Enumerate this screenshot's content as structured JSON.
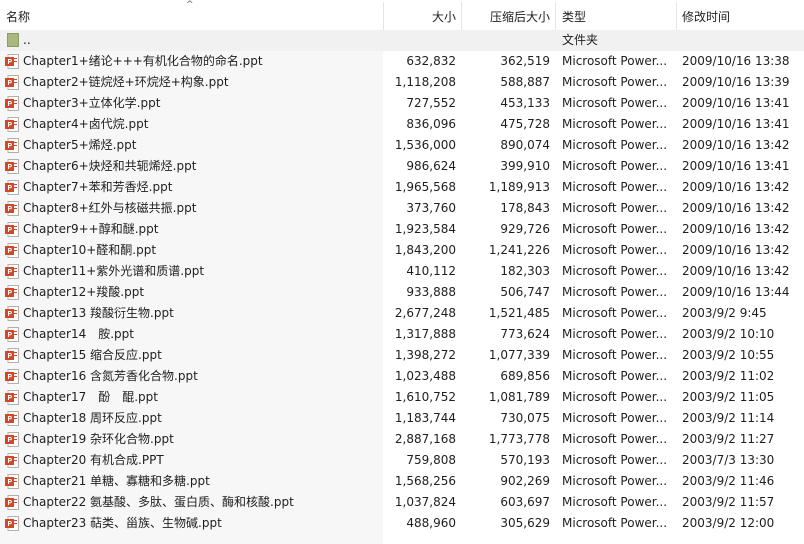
{
  "columns": {
    "name": "名称",
    "size": "大小",
    "compressed": "压缩后大小",
    "type": "类型",
    "modified": "修改时间"
  },
  "sort_arrow": "^",
  "parent_row": {
    "name": "..",
    "type": "文件夹"
  },
  "files": [
    {
      "name": "Chapter1+绪论+++有机化合物的命名.ppt",
      "size": "632,832",
      "compressed": "362,519",
      "type": "Microsoft Power...",
      "modified": "2009/10/16 13:38"
    },
    {
      "name": "Chapter2+链烷烃+环烷烃+构象.ppt",
      "size": "1,118,208",
      "compressed": "588,887",
      "type": "Microsoft Power...",
      "modified": "2009/10/16 13:39"
    },
    {
      "name": "Chapter3+立体化学.ppt",
      "size": "727,552",
      "compressed": "453,133",
      "type": "Microsoft Power...",
      "modified": "2009/10/16 13:41"
    },
    {
      "name": "Chapter4+卤代烷.ppt",
      "size": "836,096",
      "compressed": "475,728",
      "type": "Microsoft Power...",
      "modified": "2009/10/16 13:41"
    },
    {
      "name": "Chapter5+烯烃.ppt",
      "size": "1,536,000",
      "compressed": "890,074",
      "type": "Microsoft Power...",
      "modified": "2009/10/16 13:42"
    },
    {
      "name": "Chapter6+炔烃和共轭烯烃.ppt",
      "size": "986,624",
      "compressed": "399,910",
      "type": "Microsoft Power...",
      "modified": "2009/10/16 13:41"
    },
    {
      "name": "Chapter7+苯和芳香烃.ppt",
      "size": "1,965,568",
      "compressed": "1,189,913",
      "type": "Microsoft Power...",
      "modified": "2009/10/16 13:42"
    },
    {
      "name": "Chapter8+红外与核磁共振.ppt",
      "size": "373,760",
      "compressed": "178,843",
      "type": "Microsoft Power...",
      "modified": "2009/10/16 13:42"
    },
    {
      "name": "Chapter9++醇和醚.ppt",
      "size": "1,923,584",
      "compressed": "929,726",
      "type": "Microsoft Power...",
      "modified": "2009/10/16 13:42"
    },
    {
      "name": "Chapter10+醛和酮.ppt",
      "size": "1,843,200",
      "compressed": "1,241,226",
      "type": "Microsoft Power...",
      "modified": "2009/10/16 13:42"
    },
    {
      "name": "Chapter11+紫外光谱和质谱.ppt",
      "size": "410,112",
      "compressed": "182,303",
      "type": "Microsoft Power...",
      "modified": "2009/10/16 13:42"
    },
    {
      "name": "Chapter12+羧酸.ppt",
      "size": "933,888",
      "compressed": "506,747",
      "type": "Microsoft Power...",
      "modified": "2009/10/16 13:44"
    },
    {
      "name": "Chapter13 羧酸衍生物.ppt",
      "size": "2,677,248",
      "compressed": "1,521,485",
      "type": "Microsoft Power...",
      "modified": "2003/9/2 9:45"
    },
    {
      "name": "Chapter14　胺.ppt",
      "size": "1,317,888",
      "compressed": "773,624",
      "type": "Microsoft Power...",
      "modified": "2003/9/2 10:10"
    },
    {
      "name": "Chapter15 缩合反应.ppt",
      "size": "1,398,272",
      "compressed": "1,077,339",
      "type": "Microsoft Power...",
      "modified": "2003/9/2 10:55"
    },
    {
      "name": "Chapter16 含氮芳香化合物.ppt",
      "size": "1,023,488",
      "compressed": "689,856",
      "type": "Microsoft Power...",
      "modified": "2003/9/2 11:02"
    },
    {
      "name": "Chapter17　酚　醌.ppt",
      "size": "1,610,752",
      "compressed": "1,081,789",
      "type": "Microsoft Power...",
      "modified": "2003/9/2 11:05"
    },
    {
      "name": "Chapter18 周环反应.ppt",
      "size": "1,183,744",
      "compressed": "730,075",
      "type": "Microsoft Power...",
      "modified": "2003/9/2 11:14"
    },
    {
      "name": "Chapter19 杂环化合物.ppt",
      "size": "2,887,168",
      "compressed": "1,773,778",
      "type": "Microsoft Power...",
      "modified": "2003/9/2 11:27"
    },
    {
      "name": "Chapter20 有机合成.PPT",
      "size": "759,808",
      "compressed": "570,193",
      "type": "Microsoft Power...",
      "modified": "2003/7/3 13:30"
    },
    {
      "name": "Chapter21 单糖、寡糖和多糖.ppt",
      "size": "1,568,256",
      "compressed": "902,269",
      "type": "Microsoft Power...",
      "modified": "2003/9/2 11:46"
    },
    {
      "name": "Chapter22 氨基酸、多肽、蛋白质、酶和核酸.ppt",
      "size": "1,037,824",
      "compressed": "603,697",
      "type": "Microsoft Power...",
      "modified": "2003/9/2 11:57"
    },
    {
      "name": "Chapter23 萜类、甾族、生物碱.ppt",
      "size": "488,960",
      "compressed": "305,629",
      "type": "Microsoft Power...",
      "modified": "2003/9/2 12:00"
    }
  ],
  "icons": {
    "file": "powerpoint-file-icon",
    "folder": "folder-icon"
  },
  "colors": {
    "ppt_icon": "#d24726",
    "folder": "#a8b87e",
    "parent_row_bg": "#f1f1f1"
  }
}
